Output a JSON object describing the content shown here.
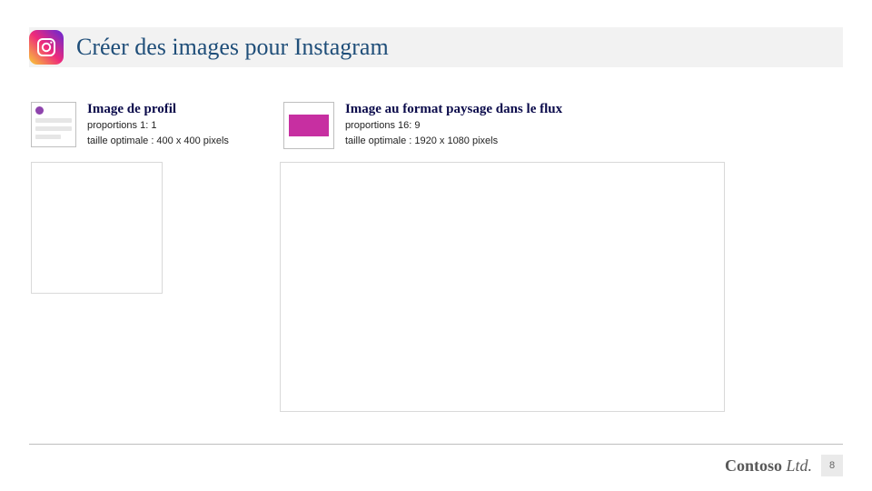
{
  "header": {
    "title": "Créer des images pour Instagram"
  },
  "columns": {
    "profile": {
      "title": "Image de profil",
      "proportions": "proportions 1: 1",
      "optimal": "taille optimale : 400 x 400 pixels"
    },
    "landscape": {
      "title": "Image au format paysage dans le flux",
      "proportions": "proportions 16: 9",
      "optimal": "taille optimale : 1920 x 1080 pixels"
    }
  },
  "footer": {
    "brand_main": "Contoso",
    "brand_suffix": " Ltd.",
    "page_number": "8"
  }
}
